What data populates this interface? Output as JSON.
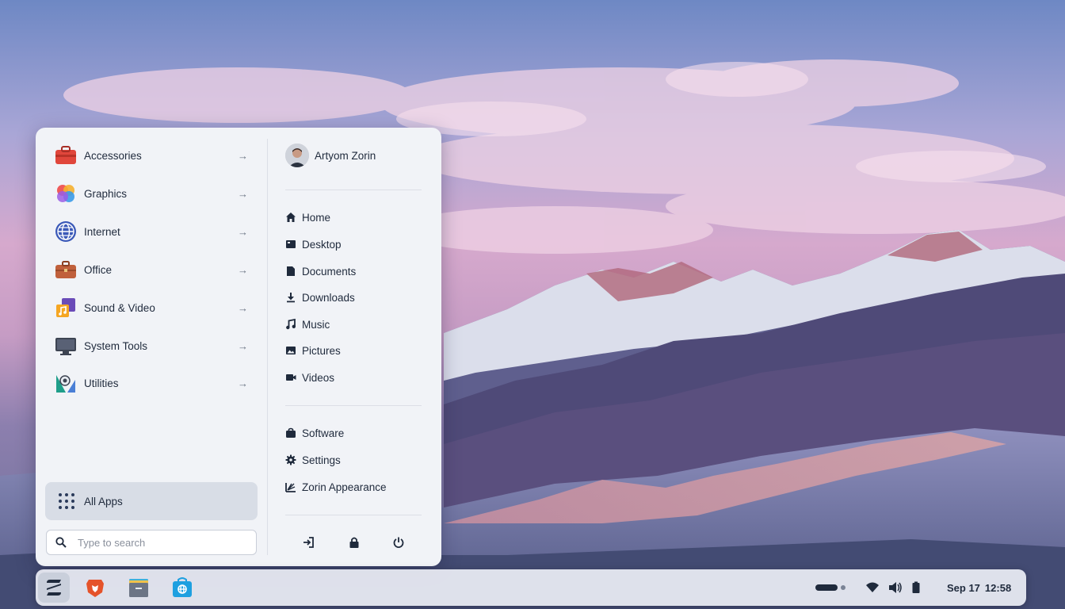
{
  "menu": {
    "categories": [
      {
        "label": "Accessories",
        "icon": "toolbox-icon",
        "arrow": "→"
      },
      {
        "label": "Graphics",
        "icon": "graphics-icon",
        "arrow": "→"
      },
      {
        "label": "Internet",
        "icon": "globe-icon",
        "arrow": "→"
      },
      {
        "label": "Office",
        "icon": "briefcase-icon",
        "arrow": "→"
      },
      {
        "label": "Sound & Video",
        "icon": "music-video-icon",
        "arrow": "→"
      },
      {
        "label": "System Tools",
        "icon": "monitor-icon",
        "arrow": "→"
      },
      {
        "label": "Utilities",
        "icon": "utilities-icon",
        "arrow": "→"
      }
    ],
    "all_apps_label": "All Apps",
    "search_placeholder": "Type to search",
    "user_name": "Artyom Zorin",
    "places": [
      {
        "label": "Home",
        "icon": "home-icon"
      },
      {
        "label": "Desktop",
        "icon": "desktop-icon"
      },
      {
        "label": "Documents",
        "icon": "document-icon"
      },
      {
        "label": "Downloads",
        "icon": "download-icon"
      },
      {
        "label": "Music",
        "icon": "music-icon"
      },
      {
        "label": "Pictures",
        "icon": "picture-icon"
      },
      {
        "label": "Videos",
        "icon": "video-icon"
      }
    ],
    "system": [
      {
        "label": "Software",
        "icon": "software-icon"
      },
      {
        "label": "Settings",
        "icon": "gear-icon"
      },
      {
        "label": "Zorin Appearance",
        "icon": "appearance-icon"
      }
    ],
    "power_actions": [
      "logout-icon",
      "lock-icon",
      "power-icon"
    ]
  },
  "taskbar": {
    "apps": [
      "zorin-menu-icon",
      "brave-browser-icon",
      "files-icon",
      "software-store-icon"
    ],
    "date": "Sep 17",
    "time": "12:58"
  },
  "colors": {
    "accent": "#1f2a3c",
    "panel": "#f1f3f7"
  }
}
